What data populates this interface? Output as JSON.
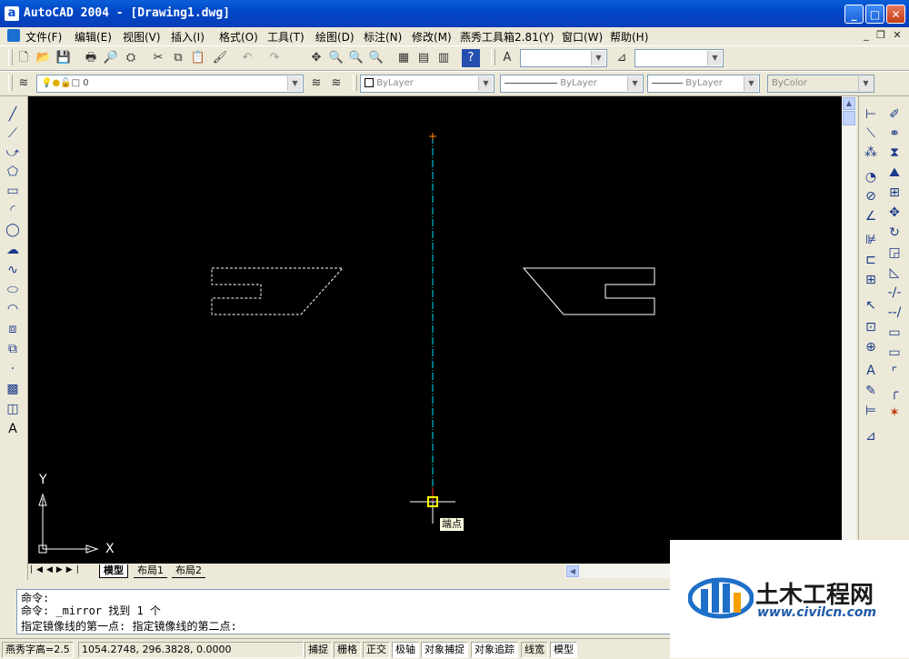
{
  "window": {
    "title": "AutoCAD 2004 - [Drawing1.dwg]",
    "app_icon": "a",
    "controls": {
      "minimize": "_",
      "maximize": "□",
      "close": "✕"
    },
    "mdi_controls": {
      "minimize": "_",
      "restore": "❐",
      "close": "✕"
    }
  },
  "menu": [
    "文件(F)",
    "编辑(E)",
    "视图(V)",
    "插入(I)",
    "格式(O)",
    "工具(T)",
    "绘图(D)",
    "标注(N)",
    "修改(M)",
    "燕秀工具箱2.81(Y)",
    "窗口(W)",
    "帮助(H)"
  ],
  "properties": {
    "layer": "0",
    "color": "ByLayer",
    "linetype": "ByLayer",
    "lineweight": "ByLayer",
    "plotstyle": "ByColor"
  },
  "canvas": {
    "background": "#000000",
    "ucs_x": "X",
    "ucs_y": "Y",
    "snap_tooltip": "端点"
  },
  "layout_tabs": {
    "model": "模型",
    "layout1": "布局1",
    "layout2": "布局2"
  },
  "command": {
    "line1": "命令:",
    "line2": "命令: _mirror 找到 1 个",
    "line3": "指定镜像线的第一点: 指定镜像线的第二点:"
  },
  "status": {
    "text_height": "燕秀字高=2.5",
    "coordinates": "1054.2748, 296.3828, 0.0000",
    "buttons": [
      "捕捉",
      "栅格",
      "正交",
      "极轴",
      "对象捕捉",
      "对象追踪",
      "线宽",
      "模型"
    ]
  },
  "watermark": {
    "name": "土木工程网",
    "url": "www.civilcn.com"
  }
}
